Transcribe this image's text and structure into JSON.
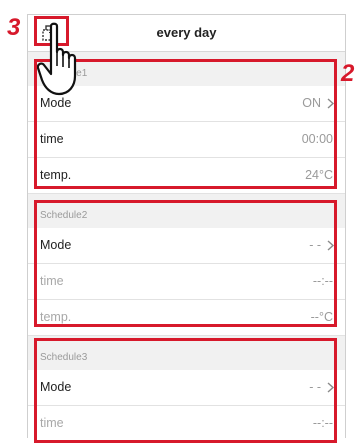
{
  "header": {
    "title": "every day"
  },
  "callouts": {
    "copy": "3",
    "schedules": "2"
  },
  "schedules": [
    {
      "label": "Schedule1",
      "rows": [
        {
          "label": "Mode",
          "value": "ON"
        },
        {
          "label": "time",
          "value": "00:00"
        },
        {
          "label": "temp.",
          "value": "24°C"
        }
      ]
    },
    {
      "label": "Schedule2",
      "rows": [
        {
          "label": "Mode",
          "value": "- -"
        },
        {
          "label": "time",
          "value": "--:--"
        },
        {
          "label": "temp.",
          "value": "--°C"
        }
      ]
    },
    {
      "label": "Schedule3",
      "rows": [
        {
          "label": "Mode",
          "value": "- -"
        },
        {
          "label": "time",
          "value": "--:--"
        }
      ]
    }
  ],
  "colors": {
    "highlight": "#d7192b"
  },
  "icons": {
    "copy": "copy-icon",
    "hand": "pointing-hand-icon",
    "chevron": "chevron-right-icon"
  }
}
